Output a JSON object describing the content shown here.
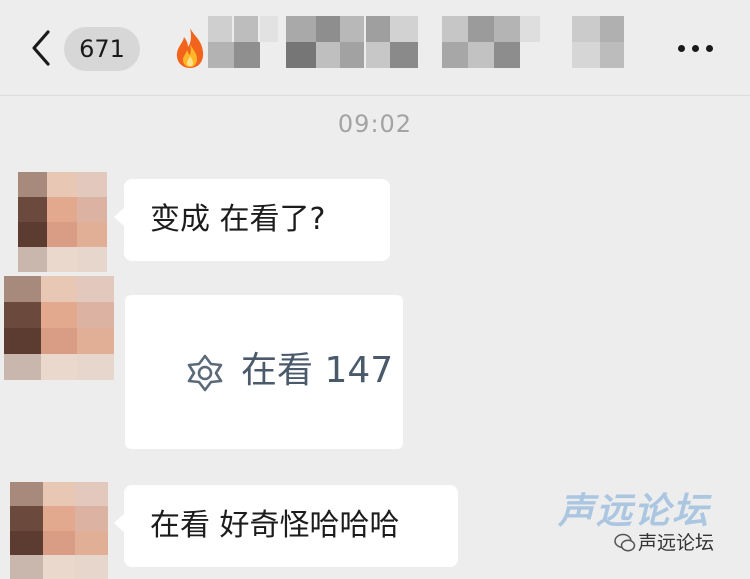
{
  "header": {
    "unread_count": "671",
    "icons": {
      "back": "chevron-left-icon",
      "fire": "fire-emoji-icon",
      "more": "more-horizontal-icon"
    }
  },
  "chat": {
    "timestamp": "09:02",
    "messages": [
      {
        "type": "text",
        "text": "变成 在看了?"
      },
      {
        "type": "card",
        "icon": "looking-icon",
        "label": "在看 147"
      },
      {
        "type": "text",
        "text": "在看 好奇怪哈哈哈"
      }
    ]
  },
  "watermark": {
    "main": "声远论坛",
    "sub": "声远论坛"
  },
  "colors": {
    "background": "#ededed",
    "bubble": "#ffffff",
    "badge": "#d7d7d7",
    "timestamp": "#a3a3a3",
    "card_label": "#4a5a6b"
  }
}
